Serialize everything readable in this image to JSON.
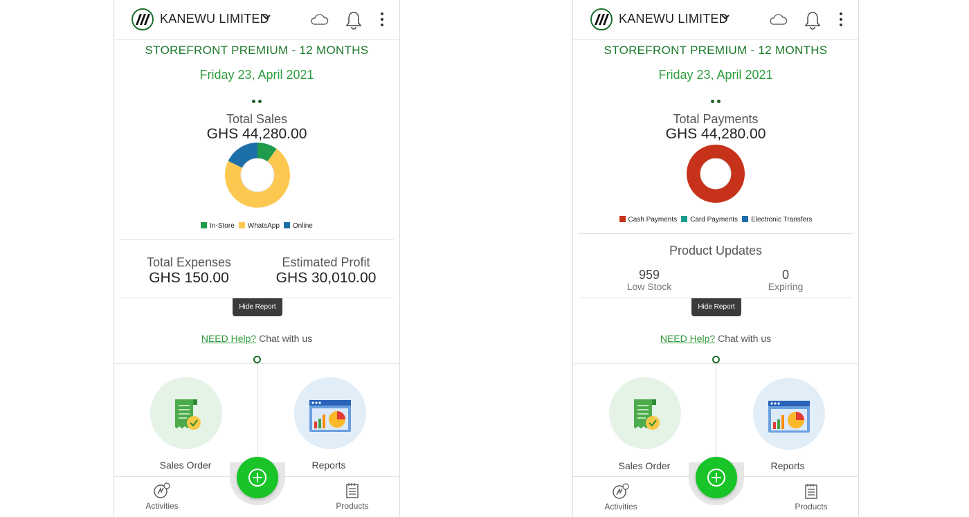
{
  "colors": {
    "brand_green": "#1a7a2a",
    "date_green": "#2e9e3e",
    "fab_green": "#18c427",
    "link_green": "#2f9a3b",
    "in_store": "#1e9b4b",
    "whatsapp": "#fcc84f",
    "online": "#1d6fa8",
    "cash": "#c6321a",
    "card": "#1a9c8c",
    "electronic": "#1d6fa8",
    "tooltip_bg": "#3b3b3b"
  },
  "icons": [
    "company-logo",
    "chevron-down-icon",
    "cloud-icon",
    "bell-icon",
    "more-vert-icon",
    "receipt-icon",
    "report-chart-icon",
    "add-icon",
    "activities-icon",
    "products-icon"
  ],
  "left": {
    "header": {
      "company": "KANEWU LIMITED"
    },
    "plan": "STOREFRONT PREMIUM - 12 MONTHS",
    "date": "Friday 23, April 2021",
    "summary": {
      "title": "Total Sales",
      "value": "GHS 44,280.00"
    },
    "chart_data": {
      "type": "pie",
      "categories": [
        "In-Store",
        "WhatsApp",
        "Online"
      ],
      "values": [
        10,
        72,
        18
      ]
    },
    "legend": [
      {
        "label": "In-Store",
        "color": "#1e9b4b"
      },
      {
        "label": "WhatsApp",
        "color": "#fcc84f"
      },
      {
        "label": "Online",
        "color": "#1d6fa8"
      }
    ],
    "expenses": {
      "title": "Total Expenses",
      "value": "GHS 150.00"
    },
    "profit": {
      "title": "Estimated Profit",
      "value": "GHS 30,010.00"
    },
    "hide_report": "Hide Report",
    "help": {
      "link": "NEED Help?",
      "text": "Chat with us"
    },
    "tiles": {
      "sales_order": "Sales Order",
      "reports": "Reports"
    },
    "nav": {
      "activities": "Activities",
      "products": "Products"
    }
  },
  "right": {
    "header": {
      "company": "KANEWU LIMITED"
    },
    "plan": "STOREFRONT PREMIUM - 12 MONTHS",
    "date": "Friday 23, April 2021",
    "summary": {
      "title": "Total Payments",
      "value": "GHS 44,280.00"
    },
    "chart_data": {
      "type": "pie",
      "categories": [
        "Cash Payments",
        "Card Payments",
        "Electronic Transfers"
      ],
      "values": [
        100,
        0,
        0
      ]
    },
    "legend": [
      {
        "label": "Cash Payments",
        "color": "#c6321a"
      },
      {
        "label": "Card Payments",
        "color": "#1a9c8c"
      },
      {
        "label": "Electronic Transfers",
        "color": "#1d6fa8"
      }
    ],
    "updates": {
      "title": "Product Updates",
      "low_stock_value": "959",
      "low_stock_label": "Low Stock",
      "expiring_value": "0",
      "expiring_label": "Expiring"
    },
    "hide_report": "Hide Report",
    "help": {
      "link": "NEED Help?",
      "text": "Chat with us"
    },
    "tiles": {
      "sales_order": "Sales Order",
      "reports": "Reports"
    },
    "nav": {
      "activities": "Activities",
      "products": "Products"
    }
  }
}
